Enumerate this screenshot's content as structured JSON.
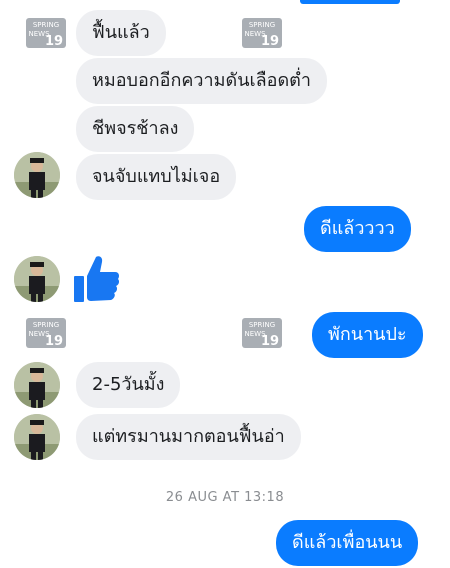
{
  "messages": [
    {
      "text": "ฟื้นแล้ว"
    },
    {
      "text": "หมอบอกอีกความดันเลือดต่ำ"
    },
    {
      "text": "ชีพจรช้าลง"
    },
    {
      "text": "จนจับแทบไม่เจอ"
    },
    {
      "text": "ดีแล้วววว"
    },
    {
      "text": "พักนานปะ"
    },
    {
      "text": "2-5วันมั้ง"
    },
    {
      "text": "แต่ทรมานมากตอนฟื้นอ่า"
    },
    {
      "text": "ดีแล้วเพื่อนนน"
    }
  ],
  "timestamp": "26 AUG AT 13:18",
  "watermark": {
    "line1": "SPRING",
    "line2": "NEWS",
    "line3": "19"
  },
  "icons": {
    "like": "thumbs-up-icon",
    "avatar": "profile-avatar"
  },
  "colors": {
    "sent": "#0a7cff",
    "received": "#eeeff2",
    "like": "#1877f2"
  }
}
